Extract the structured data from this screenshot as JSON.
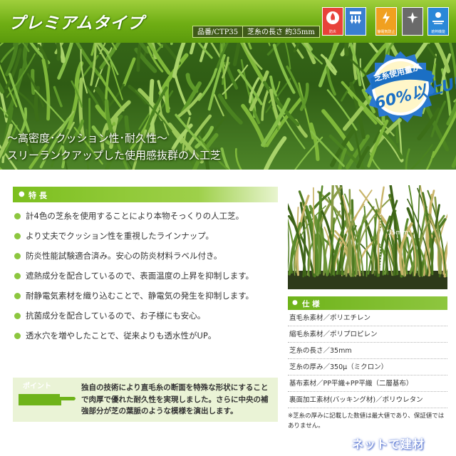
{
  "header": {
    "title": "プレミアムタイプ",
    "product_code": "品番/CTP35",
    "pile_length_label": "芝糸の長さ 約35mm",
    "icons": [
      {
        "name": "fire-resistant-icon",
        "label": "防炎",
        "color": "#e8423a"
      },
      {
        "name": "drainage-icon",
        "label": "",
        "color": "#3a7fd0"
      },
      {
        "name": "antistatic-icon",
        "label": "静電気防止",
        "color": "#f0a020"
      },
      {
        "name": "antibacterial-icon",
        "label": "",
        "color": "#6a6a6a"
      },
      {
        "name": "heat-shield-icon",
        "label": "遮熱機能",
        "color": "#2a88d8"
      }
    ]
  },
  "badge": {
    "line1": "芝糸使用量が",
    "line2": "60%以上UP"
  },
  "hero": {
    "copy_line1": "～高密度･クッション性･耐久性～",
    "copy_line2": "スリーランクアップした使用感抜群の人工芝"
  },
  "features": {
    "heading": "特 長",
    "items": [
      "計4色の芝糸を使用することにより本物そっくりの人工芝。",
      "より丈夫でクッション性を重視したラインナップ。",
      "防炎性能試験適合済み。安心の防炎材料ラベル付き。",
      "遮熱成分を配合しているので、表面温度の上昇を抑制します。",
      "耐静電気素材を織り込むことで、静電気の発生を抑制します。",
      "抗菌成分を配合しているので、お子様にも安心。",
      "透水穴を増やしたことで、従来よりも透水性がUP。"
    ]
  },
  "point": {
    "label": "ポイント",
    "text": "独自の技術により直毛糸の断面を特殊な形状にすることで肉厚で優れた耐久性を実現しました。さらに中央の補強部分が芝の葉脈のような模様を演出します。"
  },
  "photo": {
    "measure_label": "35mm"
  },
  "specs": {
    "heading": "仕 様",
    "rows": [
      "直毛糸素材／ポリエチレン",
      "縮毛糸素材／ポリプロピレン",
      "芝糸の長さ／35mm",
      "芝糸の厚み／350μ（ミクロン）",
      "基布素材／PP平織+PP平織（二層基布）",
      "裏面加工素材(バッキング材)／ポリウレタン"
    ],
    "note": "※芝糸の厚みに記載した数値は最大値であり、保証値ではありません。"
  },
  "watermark": "ネットで建材",
  "colors": {
    "brand_green": "#7cbf1e",
    "dark_green": "#3f5a18",
    "point_bg": "#eaf3d6",
    "badge_blue": "#1b6fc4"
  }
}
